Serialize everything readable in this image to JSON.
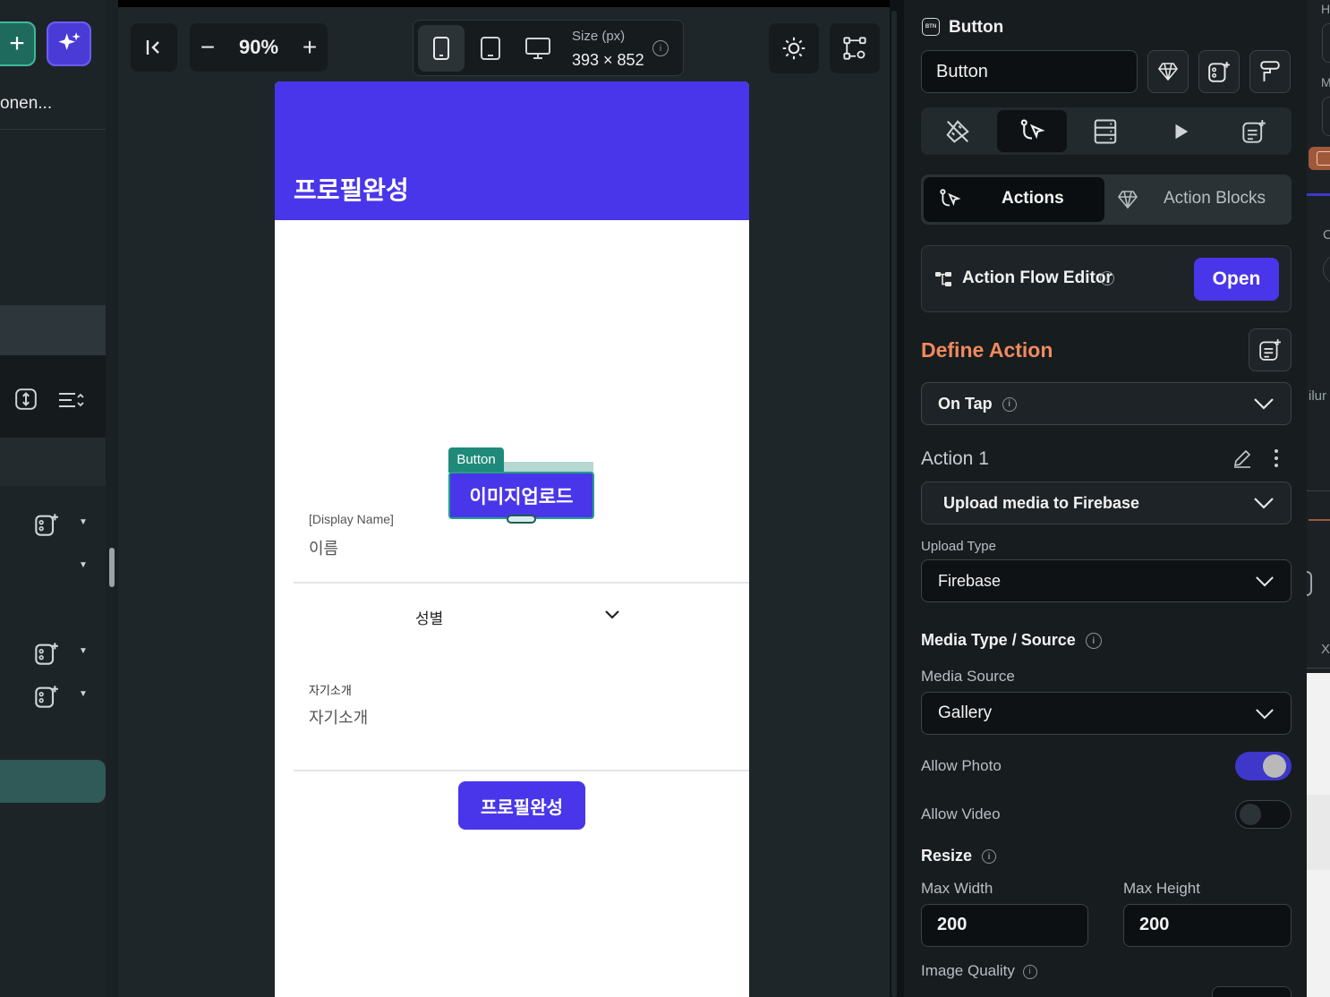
{
  "left": {
    "component_label": "onen...",
    "add_button": "+"
  },
  "toolbar": {
    "zoom_minus": "−",
    "zoom": "90%",
    "zoom_plus": "+",
    "size_label": "Size (px)",
    "size_value": "393 × 852"
  },
  "phone": {
    "appbar_title": "프로필완성",
    "selection_tag": "Button",
    "upload_button": "이미지업로드",
    "display_name_label": "[Display Name]",
    "name_placeholder": "이름",
    "gender_dropdown": "성별",
    "bio_label": "자기소개",
    "bio_placeholder": "자기소개",
    "submit_button": "프로필완성"
  },
  "panel": {
    "widget_type_badge": "BTN",
    "widget_type": "Button",
    "widget_name": "Button",
    "tabs": {
      "actions": "Actions",
      "action_blocks": "Action Blocks"
    },
    "flow_editor": {
      "label": "Action Flow Editor",
      "open": "Open"
    },
    "define_action": "Define Action",
    "trigger": "On Tap",
    "action_title": "Action 1",
    "action_type": "Upload media to Firebase",
    "upload_type_label": "Upload Type",
    "upload_type": "Firebase",
    "media_section": "Media Type / Source",
    "media_source_label": "Media Source",
    "media_source": "Gallery",
    "allow_photo": "Allow Photo",
    "allow_video": "Allow Video",
    "resize": "Resize",
    "max_width_label": "Max Width",
    "max_width": "200",
    "max_height_label": "Max Height",
    "max_height": "200",
    "image_quality": "Image Quality",
    "allow_photo_on": true,
    "allow_video_on": false
  },
  "far_right": {
    "text_h": "H",
    "text_m": "M",
    "text_c": "C",
    "text_ilur": "ilur",
    "text_x": "X"
  },
  "colors": {
    "accent": "#4a36ea",
    "define_action": "#f08a5d",
    "tag": "#1f8a7a"
  }
}
